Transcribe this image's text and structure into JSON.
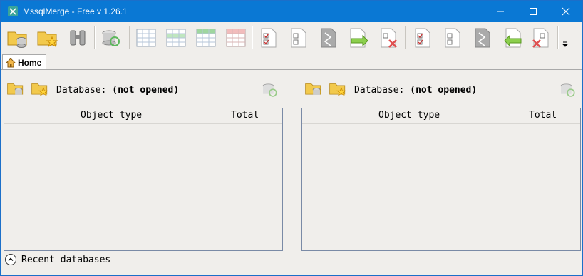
{
  "window": {
    "title": "MssqlMerge - Free v 1.26.1",
    "controls": [
      "minimize-icon",
      "maximize-icon",
      "close-icon"
    ]
  },
  "toolbar": {
    "buttons": [
      "open-database-icon",
      "open-favorite-icon",
      "compare-binoculars-icon",
      "refresh-database-icon",
      "table-grid-icon",
      "table-added-icon",
      "table-changed-icon",
      "table-removed-icon",
      "checked-left-icon",
      "unchecked-icon",
      "diff-left-icon",
      "copy-right-icon",
      "delete-right-icon",
      "checked-right-icon",
      "unchecked-right-icon",
      "diff-right-icon",
      "copy-left-icon",
      "delete-left-icon",
      "toolbar-overflow-icon"
    ]
  },
  "tabs": [
    {
      "label": "Home"
    }
  ],
  "left": {
    "db_label": "Database:",
    "db_value": "(not opened)",
    "col_object": "Object type",
    "col_total": "Total"
  },
  "right": {
    "db_label": "Database:",
    "db_value": "(not opened)",
    "col_object": "Object type",
    "col_total": "Total"
  },
  "recent": {
    "label": "Recent databases"
  },
  "colors": {
    "titlebar": "#0a78d4",
    "background": "#f0eeeb"
  }
}
